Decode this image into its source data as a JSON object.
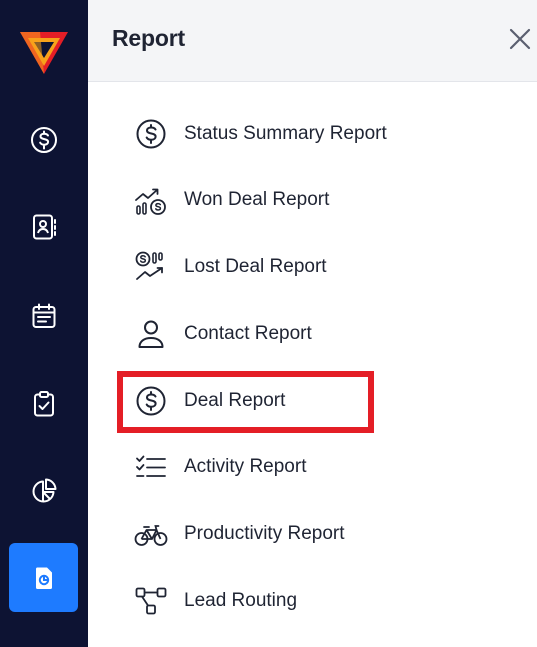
{
  "panel": {
    "title": "Report",
    "close_icon": "close-icon"
  },
  "rail": {
    "logo_colors": [
      "#e41e26",
      "#f7a21b"
    ],
    "active_color": "#1e7bff",
    "items": [
      {
        "icon": "dollar-circle-icon",
        "active": false
      },
      {
        "icon": "contacts-book-icon",
        "active": false
      },
      {
        "icon": "calendar-icon",
        "active": false
      },
      {
        "icon": "clipboard-check-icon",
        "active": false
      },
      {
        "icon": "pie-chart-icon",
        "active": false
      },
      {
        "icon": "report-file-icon",
        "active": true
      }
    ]
  },
  "menu": {
    "items": [
      {
        "label": "Status Summary Report",
        "icon": "dollar-circle-icon"
      },
      {
        "label": "Won Deal Report",
        "icon": "trend-up-coins-icon"
      },
      {
        "label": "Lost Deal Report",
        "icon": "trend-down-coins-icon"
      },
      {
        "label": "Contact Report",
        "icon": "person-icon"
      },
      {
        "label": "Deal Report",
        "icon": "dollar-circle-icon",
        "highlighted": true
      },
      {
        "label": "Activity Report",
        "icon": "checklist-icon"
      },
      {
        "label": "Productivity Report",
        "icon": "bicycle-icon"
      },
      {
        "label": "Lead Routing",
        "icon": "routing-icon"
      }
    ]
  },
  "highlight_color": "#e41e26"
}
